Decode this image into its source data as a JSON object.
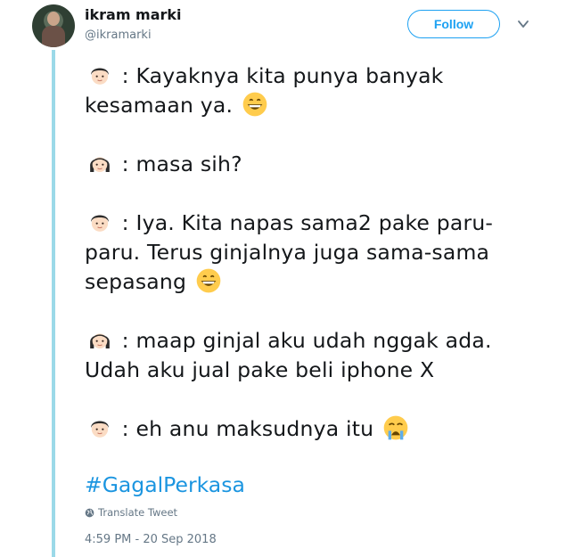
{
  "user": {
    "display_name": "ikram marki",
    "handle": "@ikramarki"
  },
  "follow_label": "Follow",
  "tweet": {
    "lines": [
      {
        "speaker": "boy",
        "text": ":  Kayaknya kita punya banyak"
      },
      {
        "speaker": null,
        "text": "kesamaan ya.",
        "emoji": "grinning-face"
      },
      {
        "speaker": "girl",
        "text": ": masa sih?"
      },
      {
        "speaker": "boy",
        "text": ": Iya. Kita napas sama2 pake paru-"
      },
      {
        "speaker": null,
        "text": "paru. Terus ginjalnya juga sama-sama"
      },
      {
        "speaker": null,
        "text": "sepasang",
        "emoji": "grinning-face"
      },
      {
        "speaker": "girl",
        "text": ": maap ginjal aku udah nggak ada."
      },
      {
        "speaker": null,
        "text": "Udah aku jual pake beli iphone X"
      },
      {
        "speaker": "boy",
        "text": ": eh anu maksudnya itu",
        "emoji": "loudly-crying-face"
      }
    ],
    "hashtag": "#GagalPerkasa"
  },
  "translate_label": "Translate Tweet",
  "timestamp": "4:59 PM - 20 Sep 2018",
  "icons": {
    "avatar": "profile-photo",
    "chevron": "chevron-down-icon",
    "globe": "globe-icon",
    "boy": "boy-emoji-icon",
    "girl": "girl-emoji-icon",
    "grin": "grinning-face-emoji-icon",
    "cry": "loudly-crying-face-emoji-icon"
  },
  "colors": {
    "link": "#1b95e0",
    "follow": "#1da1f2",
    "thread_line": "#9bd9e8",
    "muted": "#657786"
  }
}
